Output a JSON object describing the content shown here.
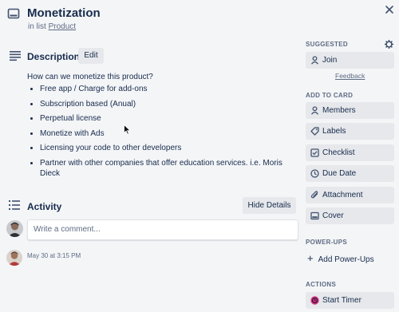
{
  "card": {
    "title": "Monetization",
    "list_prefix": "in list",
    "list_name": "Product"
  },
  "description": {
    "heading": "Description",
    "edit_label": "Edit",
    "question": "How can we monetize this product?",
    "items": [
      "Free app / Charge for add-ons",
      "Subscription based (Anual)",
      "Perpetual license",
      "Monetize with Ads",
      "Licensing your code to other developers",
      "Partner with other companies that offer education services. i.e. Moris Dieck"
    ]
  },
  "activity": {
    "heading": "Activity",
    "hide_details_label": "Hide Details",
    "comment_placeholder": "Write a comment...",
    "entry_timestamp": "May 30 at 3:15 PM"
  },
  "sidebar": {
    "suggested": {
      "heading": "SUGGESTED",
      "join_label": "Join",
      "feedback_label": "Feedback"
    },
    "add_to_card": {
      "heading": "ADD TO CARD",
      "buttons": [
        {
          "label": "Members",
          "icon": "person-icon"
        },
        {
          "label": "Labels",
          "icon": "tag-icon"
        },
        {
          "label": "Checklist",
          "icon": "checklist-icon"
        },
        {
          "label": "Due Date",
          "icon": "clock-icon"
        },
        {
          "label": "Attachment",
          "icon": "paperclip-icon"
        },
        {
          "label": "Cover",
          "icon": "cover-icon"
        }
      ]
    },
    "power_ups": {
      "heading": "POWER-UPS",
      "add_label": "Add Power-Ups"
    },
    "actions": {
      "heading": "ACTIONS",
      "start_timer_label": "Start Timer"
    }
  },
  "colors": {
    "background": "#f4f5f7",
    "button_bg": "#e6e8eb",
    "text_primary": "#172b4d",
    "text_muted": "#5e6c84",
    "timer_icon": "#d63384"
  }
}
